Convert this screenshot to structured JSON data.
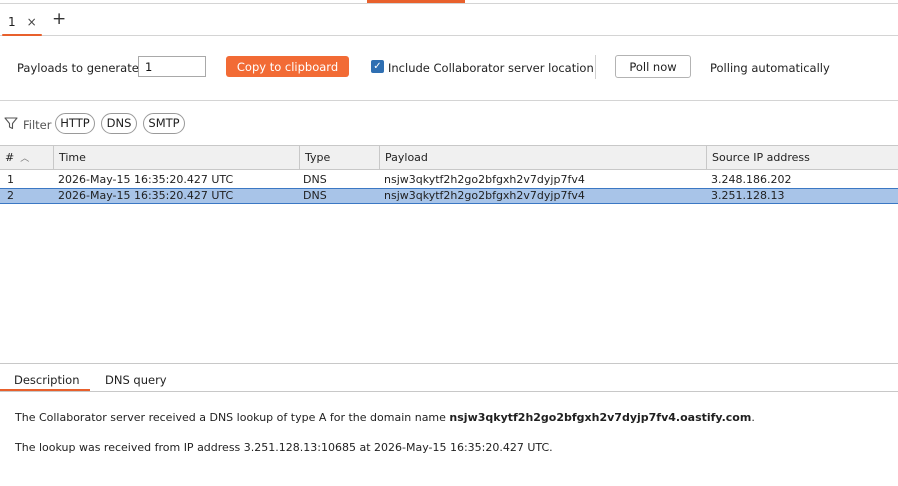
{
  "tab": {
    "label": "1",
    "close_glyph": "×",
    "add_glyph": "+"
  },
  "toolbar": {
    "payloads_label": "Payloads to generate:",
    "payloads_value": "1",
    "copy_label": "Copy to clipboard",
    "include_label": "Include Collaborator server location",
    "include_checked": true,
    "poll_label": "Poll now",
    "polling_label": "Polling automatically"
  },
  "filter": {
    "label": "Filter",
    "pills": [
      "HTTP",
      "DNS",
      "SMTP"
    ]
  },
  "table": {
    "columns": [
      "#",
      "Time",
      "Type",
      "Payload",
      "Source IP address"
    ],
    "rows": [
      {
        "num": "1",
        "time": "2026-May-15 16:35:20.427 UTC",
        "type": "DNS",
        "payload": "nsjw3qkytf2h2go2bfgxh2v7dyjp7fv4",
        "source_ip": "3.248.186.202"
      },
      {
        "num": "2",
        "time": "2026-May-15 16:35:20.427 UTC",
        "type": "DNS",
        "payload": "nsjw3qkytf2h2go2bfgxh2v7dyjp7fv4",
        "source_ip": "3.251.128.13"
      }
    ],
    "selected_row": 2
  },
  "detail": {
    "tabs": [
      "Description",
      "DNS query"
    ],
    "line1_prefix": "The Collaborator server received a DNS lookup of type A for the domain name ",
    "line1_domain": "nsjw3qkytf2h2go2bfgxh2v7dyjp7fv4.oastify.com",
    "line1_suffix": ".",
    "line2": "The lookup was received from IP address 3.251.128.13:10685 at 2026-May-15 16:35:20.427 UTC."
  },
  "colors": {
    "accent": "#f26b35",
    "selection": "#a8c4e8",
    "checkbox": "#2f6fb2"
  }
}
